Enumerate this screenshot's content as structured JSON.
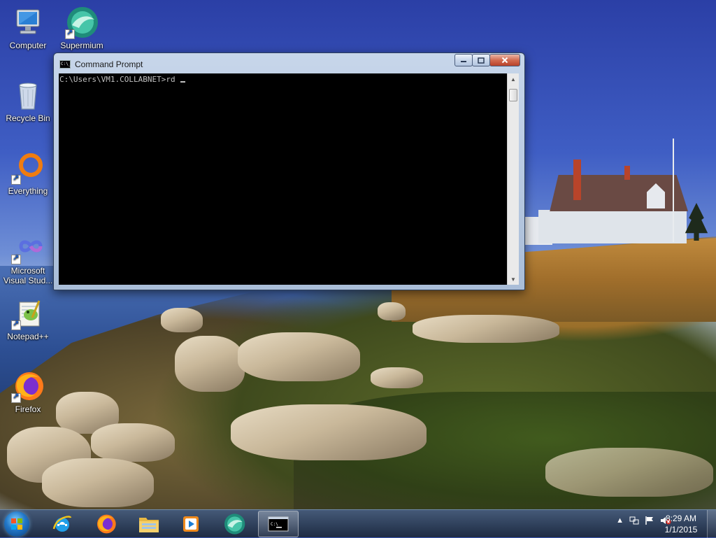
{
  "desktop": {
    "icons": [
      {
        "label": "Computer",
        "icon": "computer-icon"
      },
      {
        "label": "Supermium",
        "icon": "supermium-icon"
      },
      {
        "label": "Recycle Bin",
        "icon": "recycle-bin-icon"
      },
      {
        "label": "Everything",
        "icon": "everything-icon"
      },
      {
        "label": "Microsoft Visual Stud...",
        "icon": "visual-studio-icon"
      },
      {
        "label": "Notepad++",
        "icon": "notepad-plus-plus-icon"
      },
      {
        "label": "Firefox",
        "icon": "firefox-icon"
      }
    ]
  },
  "cmd_window": {
    "title": "Command Prompt",
    "icon_text": "C:\\_",
    "prompt": "C:\\Users\\VM1.COLLABNET>rd ",
    "buttons": {
      "minimize": "minimize",
      "maximize": "maximize",
      "close": "close"
    }
  },
  "taskbar": {
    "start": "start-button",
    "pinned": [
      {
        "name": "Internet Explorer",
        "icon": "internet-explorer-icon"
      },
      {
        "name": "Firefox",
        "icon": "firefox-icon"
      },
      {
        "name": "Windows Explorer",
        "icon": "file-explorer-icon"
      },
      {
        "name": "Windows Media Player",
        "icon": "media-player-icon"
      },
      {
        "name": "Supermium",
        "icon": "supermium-icon"
      },
      {
        "name": "Command Prompt",
        "icon": "command-prompt-icon",
        "active": true
      }
    ],
    "tray": {
      "icons": [
        "show-hidden-icons-arrow",
        "network-icon",
        "action-center-flag-icon",
        "volume-muted-icon"
      ]
    },
    "clock": {
      "time": "8:29 AM",
      "date": "1/1/2015"
    }
  },
  "colors": {
    "console_bg": "#000000",
    "console_fg": "#c0c0c0",
    "taskbar": "#2a3b52",
    "close_button": "#c7422a"
  }
}
